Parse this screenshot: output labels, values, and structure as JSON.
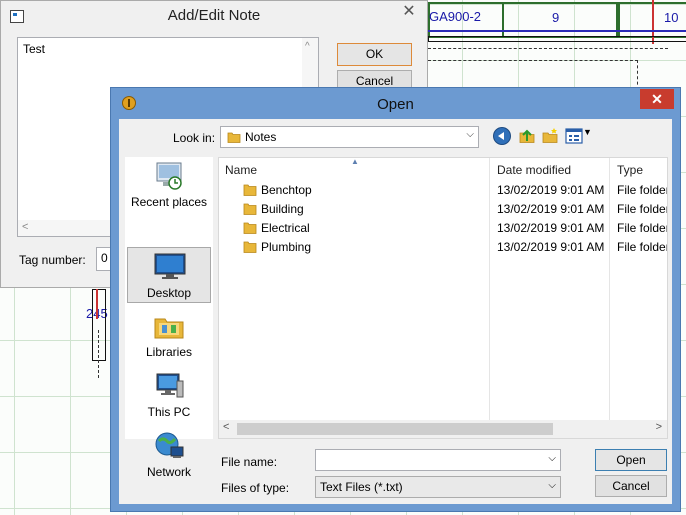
{
  "cad": {
    "label_ga": "GA900-2",
    "label_9": "9",
    "label_10": "10",
    "label_245": "245"
  },
  "note_dialog": {
    "title": "Add/Edit Note",
    "close_glyph": "✕",
    "text_value": "Test",
    "ok_label": "OK",
    "cancel_label": "Cancel",
    "tag_label": "Tag number:",
    "tag_value": "0"
  },
  "open_dialog": {
    "title": "Open",
    "close_glyph": "✕",
    "look_in_label": "Look in:",
    "look_in_value": "Notes",
    "places": [
      {
        "label": "Recent places",
        "icon": "recent-places-icon"
      },
      {
        "label": "Desktop",
        "icon": "desktop-icon",
        "selected": true
      },
      {
        "label": "Libraries",
        "icon": "libraries-icon"
      },
      {
        "label": "This PC",
        "icon": "this-pc-icon"
      },
      {
        "label": "Network",
        "icon": "network-icon"
      }
    ],
    "columns": {
      "name": "Name",
      "date": "Date modified",
      "type": "Type"
    },
    "files": [
      {
        "name": "Benchtop",
        "date": "13/02/2019 9:01 AM",
        "type": "File folder"
      },
      {
        "name": "Building",
        "date": "13/02/2019 9:01 AM",
        "type": "File folder"
      },
      {
        "name": "Electrical",
        "date": "13/02/2019 9:01 AM",
        "type": "File folder"
      },
      {
        "name": "Plumbing",
        "date": "13/02/2019 9:01 AM",
        "type": "File folder"
      }
    ],
    "file_name_label": "File name:",
    "file_name_value": "",
    "file_type_label": "Files of type:",
    "file_type_value": "Text Files (*.txt)",
    "open_label": "Open",
    "cancel_label": "Cancel"
  },
  "colors": {
    "dialog_frame": "#6c9ad1",
    "close_red": "#c83c2e",
    "folder_yellow": "#e8b73a",
    "cad_grid": "#cfe3cf",
    "cad_text": "#1a1aa8"
  }
}
